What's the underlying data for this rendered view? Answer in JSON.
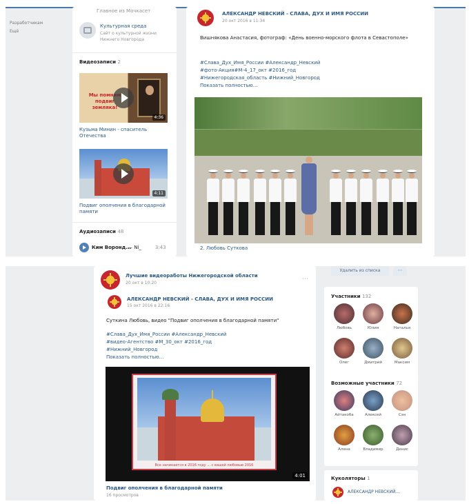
{
  "top_shot": {
    "left_nav": {
      "items": [
        "Разработчикам",
        "Ещё"
      ]
    },
    "side": {
      "partial_top_text": "Главное из Мочкасет",
      "group_name": "Культурная среда",
      "group_description": "Сайт о культурной жизни Нижнего Новгорода",
      "videos_title": "Видеозаписи",
      "videos_count": "2",
      "videos": [
        {
          "title": "Кузьма Минин - спаситель Отечества",
          "duration": "4:36",
          "overlay_text": "Мы помним подвиг земляка!"
        },
        {
          "title": "Подвиг ополчения в благодарной памяти",
          "duration": "4:11"
        }
      ],
      "audio_title": "Аудиозаписи",
      "audio_count": "48",
      "audio_item": {
        "artist": "Ким Воронд...",
        "title": "— Ni_",
        "duration": "3:43"
      }
    },
    "post": {
      "author": "АЛЕКСАНДР НЕВСКИЙ - СЛАВА, ДУХ И ИМЯ РОССИИ",
      "date": "20 окт 2016 в 11:34",
      "text": "Вишнякова Анастасия, фотограф: «День военно-морского флота в Севастополе»",
      "hashtags": [
        "#Слава_Дух_Имя_России #Александр_Невский",
        "#фото-Акция#М-4_17_окт #2016_год",
        "#Нижегородская_область #Нижний_Новгород"
      ],
      "show_more": "Показать полностью...",
      "photo_caption": "2. Любовь Суткова"
    }
  },
  "bottom_shot": {
    "header_button": "Удалить из списка",
    "repost": {
      "author": "Лучшие видеоработы Нижегородской области",
      "date": "20 окт в 10:20"
    },
    "post": {
      "author": "АЛЕКСАНДР НЕВСКИЙ - СЛАВА, ДУХ И ИМЯ РОССИИ",
      "date": "15 окт 2016 в 22:16",
      "text": "Суткина Любовь, видео \"Подвиг ополчения в благодарной памяти\"",
      "hashtags": [
        "#Слава_Дух_Имя_России #Александр_Невский",
        "#видео-Агентство #М_30_окт #2016_год",
        "#Нижний_Новгород"
      ],
      "show_more": "Показать полностью...",
      "video_duration": "4:01",
      "video_banner": "Все начинается в 2016 году ... с вашей любовью 2016",
      "video_title": "Подвиг ополчения в благодарной памяти",
      "video_views": "16 просмотров"
    },
    "participants": {
      "title": "Участники",
      "count": "132",
      "people": [
        "Любовь",
        "Юлия",
        "Наталья",
        "Олег",
        "Дмитрий",
        "Максим"
      ]
    },
    "possible_participants": {
      "title": "Возможные участники",
      "count": "72",
      "people": [
        "Айтакоба",
        "Алексей",
        "Сэн",
        "Алена",
        "Владимир",
        "Денис"
      ]
    },
    "coordinators": {
      "title": "Куколяторы",
      "count": "1",
      "item": "АЛЕКСАНДР НЕВСКИЙ..."
    },
    "colors": {
      "accent": "#4a76a8",
      "link": "#2a5885",
      "emblem_red": "#c6262e",
      "emblem_gold": "#f3c13a"
    }
  }
}
